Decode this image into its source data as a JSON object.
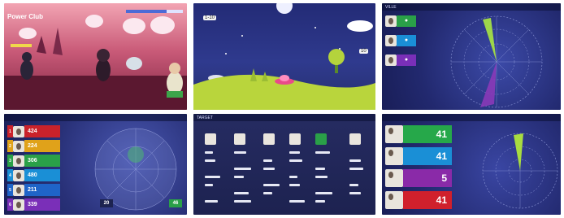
{
  "panel1": {
    "title": "Power Club"
  },
  "panel2": {
    "tag_left": "1-10",
    "tag_right": "10"
  },
  "panel3": {
    "header": "VILLE"
  },
  "panel4": {
    "rows": [
      {
        "badge": "1",
        "score": "424",
        "color": "#c9222b"
      },
      {
        "badge": "2",
        "score": "224",
        "color": "#e0a21a"
      },
      {
        "badge": "3",
        "score": "306",
        "color": "#2aa048"
      },
      {
        "badge": "4",
        "score": "480",
        "color": "#1a8fd6"
      },
      {
        "badge": "5",
        "score": "211",
        "color": "#1f64c8"
      },
      {
        "badge": "6",
        "score": "339",
        "color": "#7a2fb8"
      }
    ],
    "marker_left": "20",
    "marker_right": "46"
  },
  "panel5": {
    "header": "TARGET"
  },
  "panel6": {
    "rows": [
      {
        "score": "41",
        "color": "#26a84a"
      },
      {
        "score": "41",
        "color": "#1a8fd6"
      },
      {
        "score": "5",
        "color": "#8a2aa8"
      },
      {
        "score": "41",
        "color": "#d0202c"
      }
    ]
  }
}
